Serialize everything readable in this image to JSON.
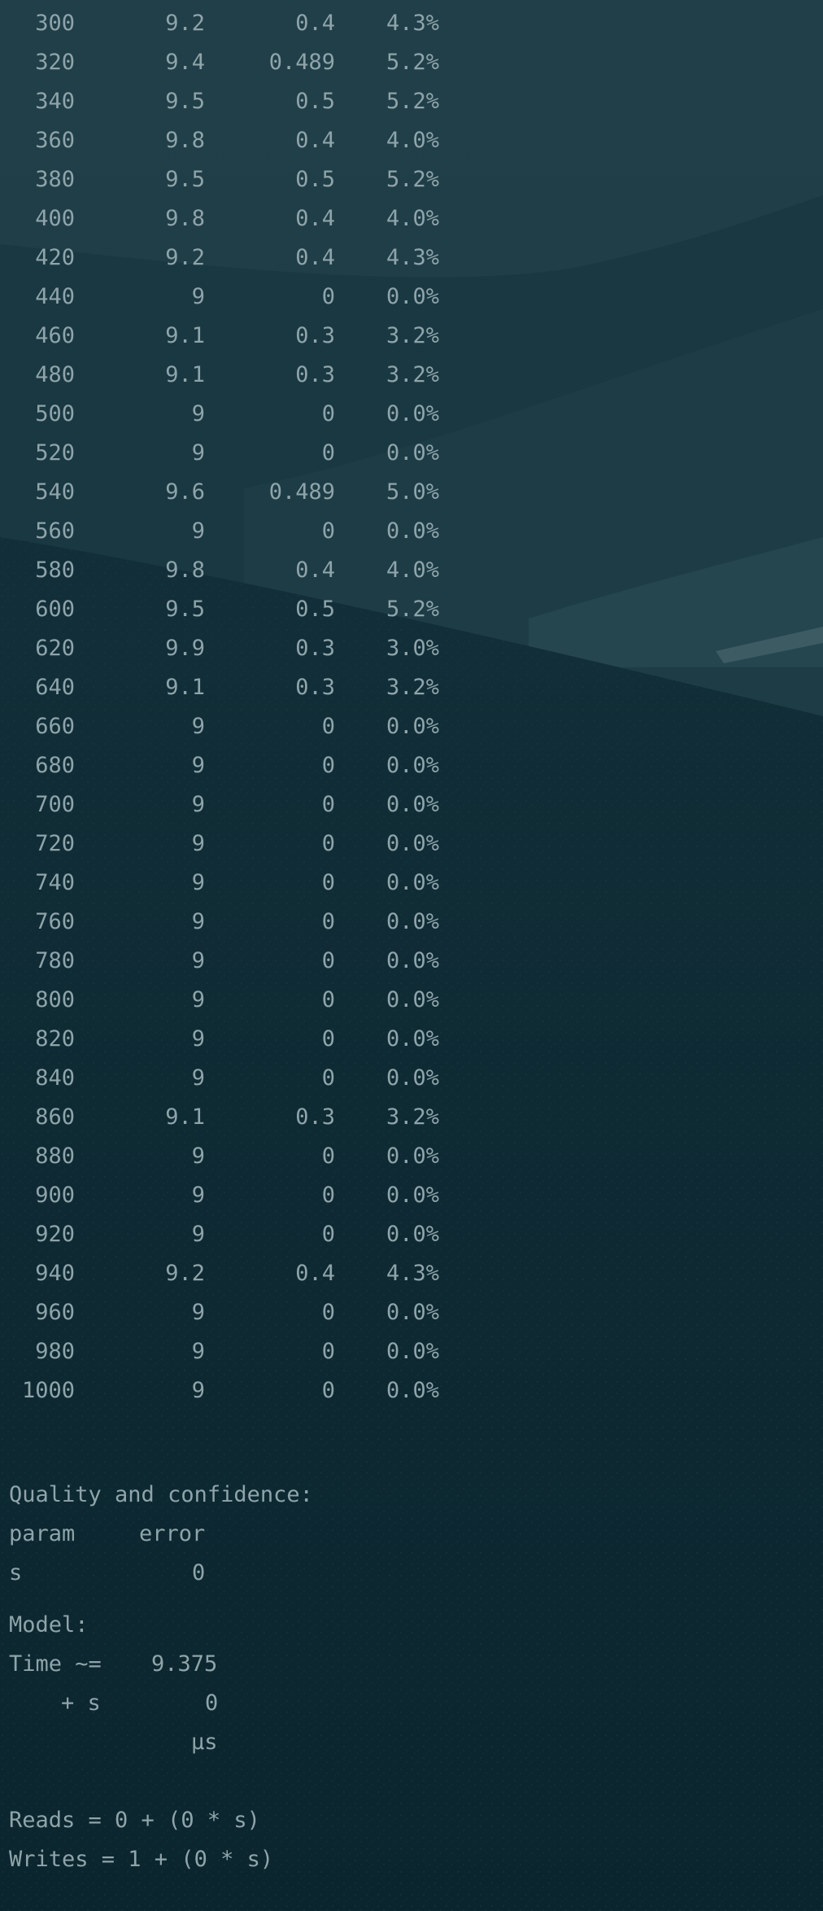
{
  "results_table": {
    "rows": [
      {
        "n": "300",
        "mean": "9.2",
        "sd": "0.4",
        "pct": "4.3%"
      },
      {
        "n": "320",
        "mean": "9.4",
        "sd": "0.489",
        "pct": "5.2%"
      },
      {
        "n": "340",
        "mean": "9.5",
        "sd": "0.5",
        "pct": "5.2%"
      },
      {
        "n": "360",
        "mean": "9.8",
        "sd": "0.4",
        "pct": "4.0%"
      },
      {
        "n": "380",
        "mean": "9.5",
        "sd": "0.5",
        "pct": "5.2%"
      },
      {
        "n": "400",
        "mean": "9.8",
        "sd": "0.4",
        "pct": "4.0%"
      },
      {
        "n": "420",
        "mean": "9.2",
        "sd": "0.4",
        "pct": "4.3%"
      },
      {
        "n": "440",
        "mean": "9",
        "sd": "0",
        "pct": "0.0%"
      },
      {
        "n": "460",
        "mean": "9.1",
        "sd": "0.3",
        "pct": "3.2%"
      },
      {
        "n": "480",
        "mean": "9.1",
        "sd": "0.3",
        "pct": "3.2%"
      },
      {
        "n": "500",
        "mean": "9",
        "sd": "0",
        "pct": "0.0%"
      },
      {
        "n": "520",
        "mean": "9",
        "sd": "0",
        "pct": "0.0%"
      },
      {
        "n": "540",
        "mean": "9.6",
        "sd": "0.489",
        "pct": "5.0%"
      },
      {
        "n": "560",
        "mean": "9",
        "sd": "0",
        "pct": "0.0%"
      },
      {
        "n": "580",
        "mean": "9.8",
        "sd": "0.4",
        "pct": "4.0%"
      },
      {
        "n": "600",
        "mean": "9.5",
        "sd": "0.5",
        "pct": "5.2%"
      },
      {
        "n": "620",
        "mean": "9.9",
        "sd": "0.3",
        "pct": "3.0%"
      },
      {
        "n": "640",
        "mean": "9.1",
        "sd": "0.3",
        "pct": "3.2%"
      },
      {
        "n": "660",
        "mean": "9",
        "sd": "0",
        "pct": "0.0%"
      },
      {
        "n": "680",
        "mean": "9",
        "sd": "0",
        "pct": "0.0%"
      },
      {
        "n": "700",
        "mean": "9",
        "sd": "0",
        "pct": "0.0%"
      },
      {
        "n": "720",
        "mean": "9",
        "sd": "0",
        "pct": "0.0%"
      },
      {
        "n": "740",
        "mean": "9",
        "sd": "0",
        "pct": "0.0%"
      },
      {
        "n": "760",
        "mean": "9",
        "sd": "0",
        "pct": "0.0%"
      },
      {
        "n": "780",
        "mean": "9",
        "sd": "0",
        "pct": "0.0%"
      },
      {
        "n": "800",
        "mean": "9",
        "sd": "0",
        "pct": "0.0%"
      },
      {
        "n": "820",
        "mean": "9",
        "sd": "0",
        "pct": "0.0%"
      },
      {
        "n": "840",
        "mean": "9",
        "sd": "0",
        "pct": "0.0%"
      },
      {
        "n": "860",
        "mean": "9.1",
        "sd": "0.3",
        "pct": "3.2%"
      },
      {
        "n": "880",
        "mean": "9",
        "sd": "0",
        "pct": "0.0%"
      },
      {
        "n": "900",
        "mean": "9",
        "sd": "0",
        "pct": "0.0%"
      },
      {
        "n": "920",
        "mean": "9",
        "sd": "0",
        "pct": "0.0%"
      },
      {
        "n": "940",
        "mean": "9.2",
        "sd": "0.4",
        "pct": "4.3%"
      },
      {
        "n": "960",
        "mean": "9",
        "sd": "0",
        "pct": "0.0%"
      },
      {
        "n": "980",
        "mean": "9",
        "sd": "0",
        "pct": "0.0%"
      },
      {
        "n": "1000",
        "mean": "9",
        "sd": "0",
        "pct": "0.0%"
      }
    ]
  },
  "quality": {
    "heading": "Quality and confidence:",
    "col_param": "param",
    "col_error": "error",
    "param_name": "s",
    "param_error": "0"
  },
  "model": {
    "heading": "Model:",
    "time_label": "Time ~=",
    "time_value": "9.375",
    "plus_s_label": "+ s",
    "plus_s_value": "0",
    "unit": "µs"
  },
  "io": {
    "reads": "Reads = 0 + (0 * s)",
    "writes": "Writes = 1 + (0 * s)"
  },
  "colors": {
    "text": "#8fa4aa",
    "overlay": "#0d2a34"
  }
}
